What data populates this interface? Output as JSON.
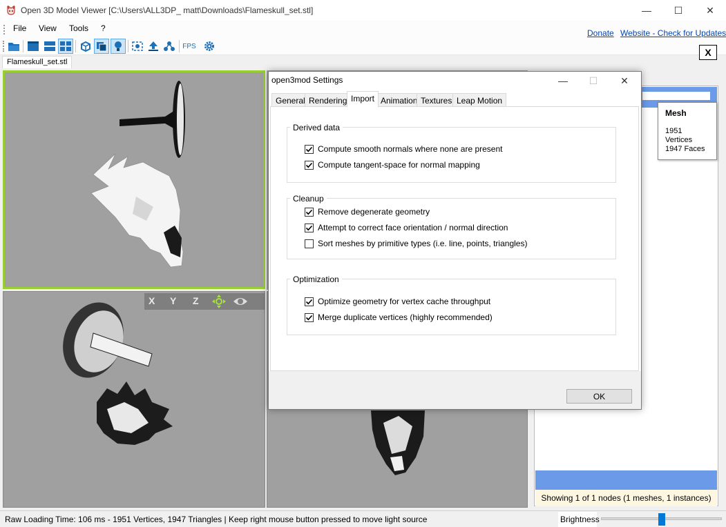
{
  "window": {
    "title": "Open 3D Model Viewer  [C:\\Users\\ALL3DP_ matt\\Downloads\\Flameskull_set.stl]",
    "minimize": "—",
    "maximize": "☐",
    "close": "✕"
  },
  "menu": {
    "file": "File",
    "view": "View",
    "tools": "Tools",
    "help": "?",
    "donate": "Donate",
    "website": "Website - Check for Updates"
  },
  "toolbar": {
    "fps": "FPS",
    "close_tab": "X"
  },
  "file_tab": "Flameskull_set.stl",
  "viewport": {
    "axis_x": "X",
    "axis_y": "Y",
    "axis_z": "Z"
  },
  "mesh_panel": {
    "heading": "Mesh",
    "vertices": "1951 Vertices",
    "faces": "1947 Faces",
    "status": "Showing 1 of 1 nodes (1 meshes, 1 instances)"
  },
  "statusbar": {
    "text": "Raw Loading Time: 106 ms - 1951 Vertices, 1947 Triangles   | Keep right mouse button pressed to move light source",
    "brightness_label": "Brightness",
    "brightness_level": 0.5
  },
  "dialog": {
    "title": "open3mod Settings",
    "tabs": [
      "General",
      "Rendering",
      "Import",
      "Animation",
      "Textures",
      "Leap Motion"
    ],
    "active_tab": "Import",
    "groups": [
      {
        "legend": "Derived data",
        "options": [
          {
            "label": "Compute smooth normals where none are present",
            "checked": true
          },
          {
            "label": "Compute tangent-space for normal mapping",
            "checked": true
          }
        ]
      },
      {
        "legend": "Cleanup",
        "options": [
          {
            "label": "Remove degenerate geometry",
            "checked": true
          },
          {
            "label": "Attempt to correct face orientation / normal direction",
            "checked": true
          },
          {
            "label": "Sort meshes by primitive types (i.e. line, points, triangles)",
            "checked": false
          }
        ]
      },
      {
        "legend": "Optimization",
        "options": [
          {
            "label": "Optimize geometry for vertex cache throughput",
            "checked": true
          },
          {
            "label": "Merge duplicate vertices (highly recommended)",
            "checked": true
          }
        ]
      }
    ],
    "ok": "OK"
  },
  "colors": {
    "viewport_bg": "#a0a0a0",
    "active_viewport_border": "#9acd32",
    "accent": "#0078d7",
    "tree_highlight": "#6a9ae8"
  }
}
